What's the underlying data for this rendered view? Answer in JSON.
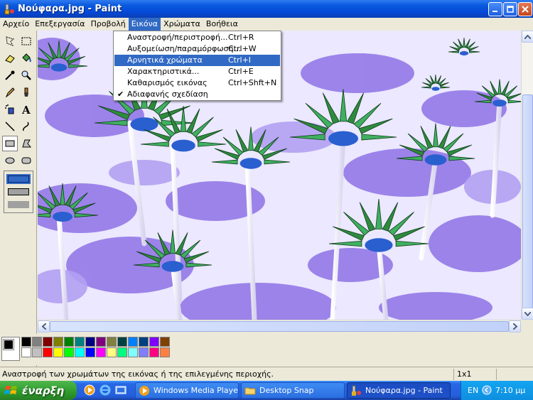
{
  "window": {
    "title": "Νούφαρα.jpg - Paint"
  },
  "menubar": {
    "items": [
      "Αρχείο",
      "Επεξεργασία",
      "Προβολή",
      "Εικόνα",
      "Χρώματα",
      "Βοήθεια"
    ],
    "open_index": 3
  },
  "image_menu": {
    "items": [
      {
        "label": "Αναστροφή/περιστροφή...",
        "shortcut": "Ctrl+R"
      },
      {
        "label": "Αυξομείωση/παραμόρφωση...",
        "shortcut": "Ctrl+W"
      },
      {
        "label": "Αρνητικά χρώματα",
        "shortcut": "Ctrl+I",
        "highlighted": true
      },
      {
        "label": "Χαρακτηριστικά...",
        "shortcut": "Ctrl+E"
      },
      {
        "label": "Καθαρισμός εικόνας",
        "shortcut": "Ctrl+Shft+N"
      },
      {
        "label": "Αδιαφανής σχεδίαση",
        "shortcut": "",
        "checked": true
      }
    ]
  },
  "toolbox": {
    "tools": [
      "free-select-icon",
      "rect-select-icon",
      "eraser-icon",
      "fill-bucket-icon",
      "color-picker-icon",
      "magnifier-icon",
      "pencil-icon",
      "brush-icon",
      "airbrush-icon",
      "text-icon",
      "line-icon",
      "curve-icon",
      "rectangle-icon",
      "polygon-icon",
      "ellipse-icon",
      "rounded-rect-icon"
    ],
    "selected_tool": "rectangle-icon"
  },
  "palette": {
    "top_row": [
      "#000000",
      "#808080",
      "#800000",
      "#808000",
      "#008000",
      "#008080",
      "#000080",
      "#800080",
      "#808040",
      "#004040",
      "#0080ff",
      "#004080",
      "#8000ff",
      "#804000"
    ],
    "bottom_row": [
      "#ffffff",
      "#c0c0c0",
      "#ff0000",
      "#ffff00",
      "#00ff00",
      "#00ffff",
      "#0000ff",
      "#ff00ff",
      "#ffff80",
      "#00ff80",
      "#80ffff",
      "#8080ff",
      "#ff0080",
      "#ff8040"
    ]
  },
  "status": {
    "help_text": "Αναστροφή των χρωμάτων της εικόνας ή της επιλεγμένης περιοχής.",
    "size": "1x1"
  },
  "taskbar": {
    "start_label": "έναρξη",
    "tasks": [
      {
        "label": "Windows Media Player",
        "active": false
      },
      {
        "label": "Desktop Snap",
        "active": false
      },
      {
        "label": "Νούφαρα.jpg - Paint",
        "active": true
      }
    ],
    "language": "EN",
    "clock": "7:10 μμ"
  }
}
